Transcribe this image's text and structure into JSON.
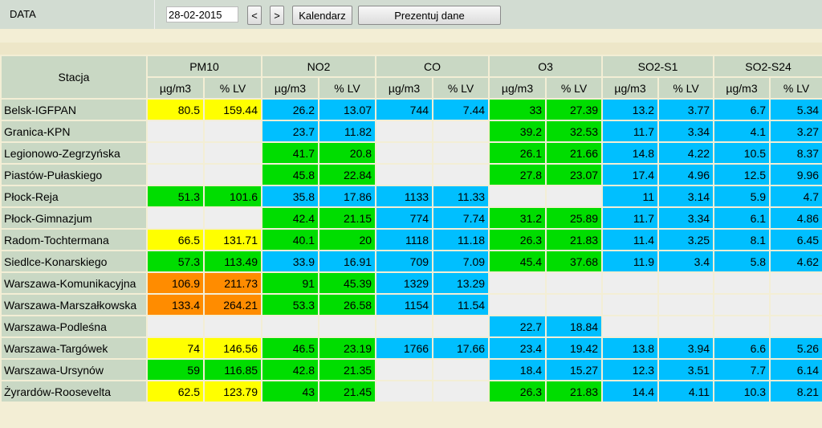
{
  "toolbar": {
    "data_label": "DATA",
    "date_value": "28-02-2015",
    "prev_label": "<",
    "next_label": ">",
    "calendar_label": "Kalendarz",
    "present_label": "Prezentuj dane"
  },
  "colors": {
    "yellow": "#ffff00",
    "blue": "#00bfff",
    "green": "#00dd00",
    "orange": "#ff8c00",
    "empty": "#eeeeee",
    "header": "#c9d8c4",
    "toolbar": "#d2dcd2",
    "background": "#f3eed5"
  },
  "table": {
    "station_header": "Stacja",
    "pollutants": [
      "PM10",
      "NO2",
      "CO",
      "O3",
      "SO2-S1",
      "SO2-S24"
    ],
    "unit_label": "µg/m3",
    "lv_label": "% LV",
    "rows": [
      {
        "station": "Belsk-IGFPAN",
        "cells": [
          [
            "80.5",
            "159.44",
            "y"
          ],
          [
            "26.2",
            "13.07",
            "b"
          ],
          [
            "744",
            "7.44",
            "b"
          ],
          [
            "33",
            "27.39",
            "g"
          ],
          [
            "13.2",
            "3.77",
            "b"
          ],
          [
            "6.7",
            "5.34",
            "b"
          ]
        ]
      },
      {
        "station": "Granica-KPN",
        "cells": [
          [
            "",
            "",
            "e"
          ],
          [
            "23.7",
            "11.82",
            "b"
          ],
          [
            "",
            "",
            "e"
          ],
          [
            "39.2",
            "32.53",
            "g"
          ],
          [
            "11.7",
            "3.34",
            "b"
          ],
          [
            "4.1",
            "3.27",
            "b"
          ]
        ]
      },
      {
        "station": "Legionowo-Zegrzyńska",
        "cells": [
          [
            "",
            "",
            "e"
          ],
          [
            "41.7",
            "20.8",
            "g"
          ],
          [
            "",
            "",
            "e"
          ],
          [
            "26.1",
            "21.66",
            "g"
          ],
          [
            "14.8",
            "4.22",
            "b"
          ],
          [
            "10.5",
            "8.37",
            "b"
          ]
        ]
      },
      {
        "station": "Piastów-Pułaskiego",
        "cells": [
          [
            "",
            "",
            "e"
          ],
          [
            "45.8",
            "22.84",
            "g"
          ],
          [
            "",
            "",
            "e"
          ],
          [
            "27.8",
            "23.07",
            "g"
          ],
          [
            "17.4",
            "4.96",
            "b"
          ],
          [
            "12.5",
            "9.96",
            "b"
          ]
        ]
      },
      {
        "station": "Płock-Reja",
        "cells": [
          [
            "51.3",
            "101.6",
            "g"
          ],
          [
            "35.8",
            "17.86",
            "b"
          ],
          [
            "1133",
            "11.33",
            "b"
          ],
          [
            "",
            "",
            "e"
          ],
          [
            "11",
            "3.14",
            "b"
          ],
          [
            "5.9",
            "4.7",
            "b"
          ]
        ]
      },
      {
        "station": "Płock-Gimnazjum",
        "cells": [
          [
            "",
            "",
            "e"
          ],
          [
            "42.4",
            "21.15",
            "g"
          ],
          [
            "774",
            "7.74",
            "b"
          ],
          [
            "31.2",
            "25.89",
            "g"
          ],
          [
            "11.7",
            "3.34",
            "b"
          ],
          [
            "6.1",
            "4.86",
            "b"
          ]
        ]
      },
      {
        "station": "Radom-Tochtermana",
        "cells": [
          [
            "66.5",
            "131.71",
            "y"
          ],
          [
            "40.1",
            "20",
            "g"
          ],
          [
            "1118",
            "11.18",
            "b"
          ],
          [
            "26.3",
            "21.83",
            "g"
          ],
          [
            "11.4",
            "3.25",
            "b"
          ],
          [
            "8.1",
            "6.45",
            "b"
          ]
        ]
      },
      {
        "station": "Siedlce-Konarskiego",
        "cells": [
          [
            "57.3",
            "113.49",
            "g"
          ],
          [
            "33.9",
            "16.91",
            "b"
          ],
          [
            "709",
            "7.09",
            "b"
          ],
          [
            "45.4",
            "37.68",
            "g"
          ],
          [
            "11.9",
            "3.4",
            "b"
          ],
          [
            "5.8",
            "4.62",
            "b"
          ]
        ]
      },
      {
        "station": "Warszawa-Komunikacyjna",
        "cells": [
          [
            "106.9",
            "211.73",
            "o"
          ],
          [
            "91",
            "45.39",
            "g"
          ],
          [
            "1329",
            "13.29",
            "b"
          ],
          [
            "",
            "",
            "e"
          ],
          [
            "",
            "",
            "e"
          ],
          [
            "",
            "",
            "e"
          ]
        ]
      },
      {
        "station": "Warszawa-Marszałkowska",
        "cells": [
          [
            "133.4",
            "264.21",
            "o"
          ],
          [
            "53.3",
            "26.58",
            "g"
          ],
          [
            "1154",
            "11.54",
            "b"
          ],
          [
            "",
            "",
            "e"
          ],
          [
            "",
            "",
            "e"
          ],
          [
            "",
            "",
            "e"
          ]
        ]
      },
      {
        "station": "Warszawa-Podleśna",
        "cells": [
          [
            "",
            "",
            "e"
          ],
          [
            "",
            "",
            "e"
          ],
          [
            "",
            "",
            "e"
          ],
          [
            "22.7",
            "18.84",
            "b"
          ],
          [
            "",
            "",
            "e"
          ],
          [
            "",
            "",
            "e"
          ]
        ]
      },
      {
        "station": "Warszawa-Targówek",
        "cells": [
          [
            "74",
            "146.56",
            "y"
          ],
          [
            "46.5",
            "23.19",
            "g"
          ],
          [
            "1766",
            "17.66",
            "b"
          ],
          [
            "23.4",
            "19.42",
            "b"
          ],
          [
            "13.8",
            "3.94",
            "b"
          ],
          [
            "6.6",
            "5.26",
            "b"
          ]
        ]
      },
      {
        "station": "Warszawa-Ursynów",
        "cells": [
          [
            "59",
            "116.85",
            "g"
          ],
          [
            "42.8",
            "21.35",
            "g"
          ],
          [
            "",
            "",
            "e"
          ],
          [
            "18.4",
            "15.27",
            "b"
          ],
          [
            "12.3",
            "3.51",
            "b"
          ],
          [
            "7.7",
            "6.14",
            "b"
          ]
        ]
      },
      {
        "station": "Żyrardów-Roosevelta",
        "cells": [
          [
            "62.5",
            "123.79",
            "y"
          ],
          [
            "43",
            "21.45",
            "g"
          ],
          [
            "",
            "",
            "e"
          ],
          [
            "26.3",
            "21.83",
            "g"
          ],
          [
            "14.4",
            "4.11",
            "b"
          ],
          [
            "10.3",
            "8.21",
            "b"
          ]
        ]
      }
    ]
  }
}
